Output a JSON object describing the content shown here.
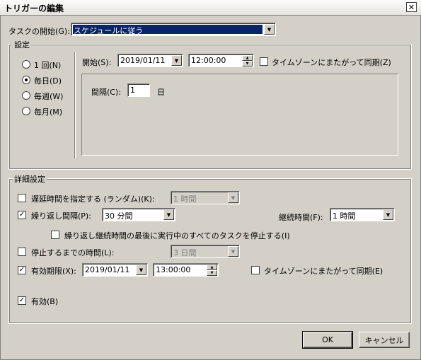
{
  "window": {
    "title": "トリガーの編集",
    "close_glyph": "✕"
  },
  "task_start": {
    "label": "タスクの開始(G):",
    "value": "スケジュールに従う"
  },
  "settings": {
    "legend": "設定",
    "radios": [
      {
        "label": "1 回(N)",
        "selected": false
      },
      {
        "label": "毎日(D)",
        "selected": true
      },
      {
        "label": "毎週(W)",
        "selected": false
      },
      {
        "label": "毎月(M)",
        "selected": false
      }
    ],
    "start_label": "開始(S):",
    "start_date": "2019/01/11",
    "start_time": "12:00:00",
    "sync_timezone": {
      "label": "タイムゾーンにまたがって同期(Z)",
      "checked": false
    },
    "interval_label": "間隔(C):",
    "interval_value": "1",
    "interval_unit": "日"
  },
  "advanced": {
    "legend": "詳細設定",
    "delay": {
      "label": "遅延時間を指定する (ランダム)(K):",
      "checked": false,
      "value": "1 時間"
    },
    "repeat": {
      "label": "繰り返し間隔(P):",
      "checked": true,
      "value": "30 分間"
    },
    "duration": {
      "label": "継続時間(F):",
      "value": "1 時間"
    },
    "stop_all": {
      "label": "繰り返し継続時間の最後に実行中のすべてのタスクを停止する(I)",
      "checked": false
    },
    "stop_after": {
      "label": "停止するまでの時間(L):",
      "checked": false,
      "value": "3 日間"
    },
    "expire": {
      "label": "有効期限(X):",
      "checked": true,
      "date": "2019/01/11",
      "time": "13:00:00"
    },
    "expire_sync": {
      "label": "タイムゾーンにまたがって同期(E)",
      "checked": false
    },
    "enabled": {
      "label": "有効(B)",
      "checked": true
    }
  },
  "buttons": {
    "ok": "OK",
    "cancel": "キャンセル"
  },
  "glyphs": {
    "check": "✓",
    "down": "▼",
    "up": "▲"
  }
}
